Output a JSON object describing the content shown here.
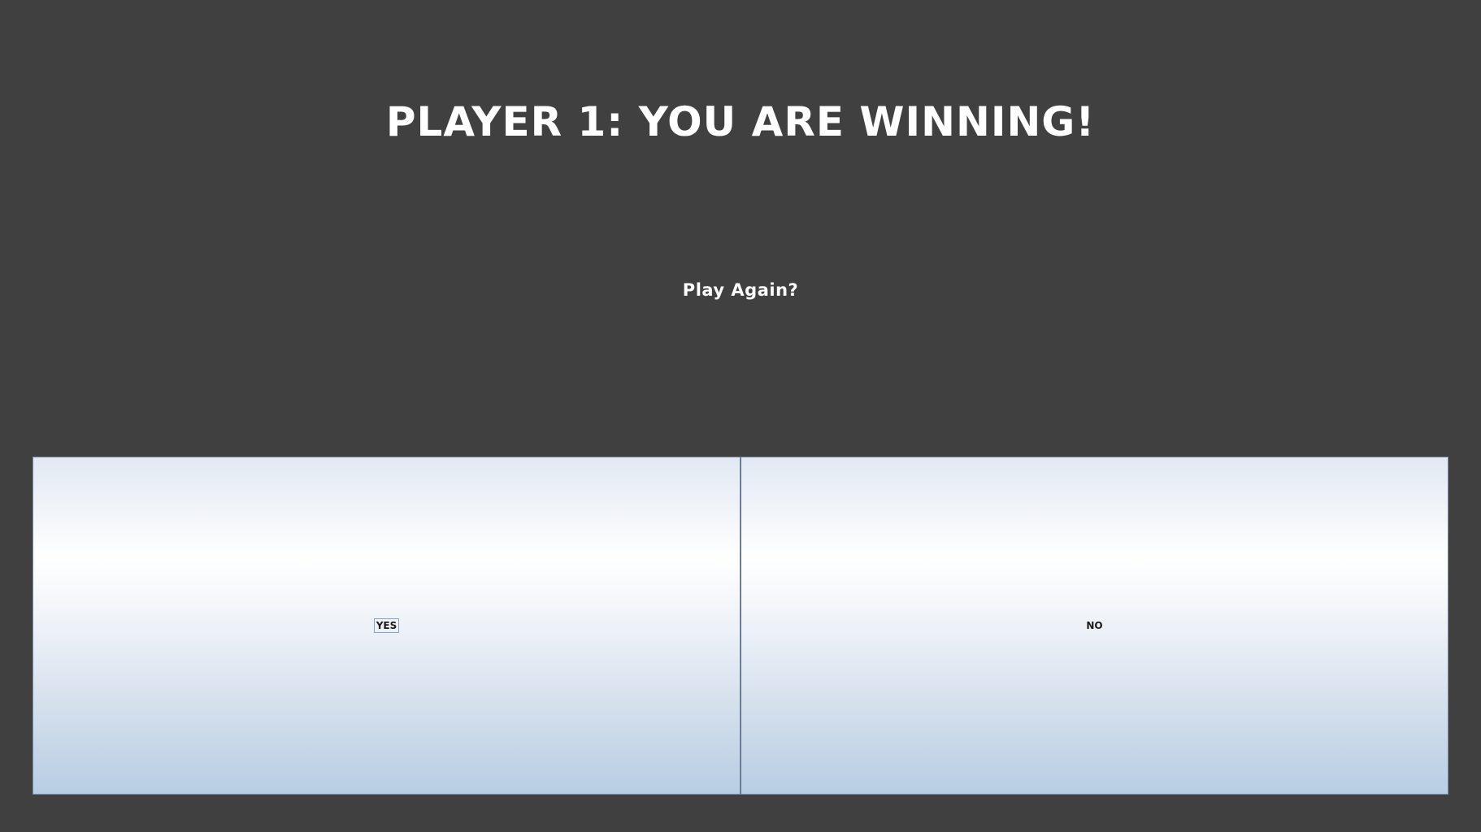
{
  "game": {
    "status_message": "PLAYER 1: YOU ARE WINNING!",
    "prompt": "Play Again?"
  },
  "buttons": {
    "yes_label": "YES",
    "no_label": "NO",
    "focused": "yes"
  },
  "colors": {
    "background": "#404040",
    "text": "#ffffff",
    "button_gradient_top": "#e2e9f3",
    "button_gradient_bottom": "#b8cde4"
  }
}
